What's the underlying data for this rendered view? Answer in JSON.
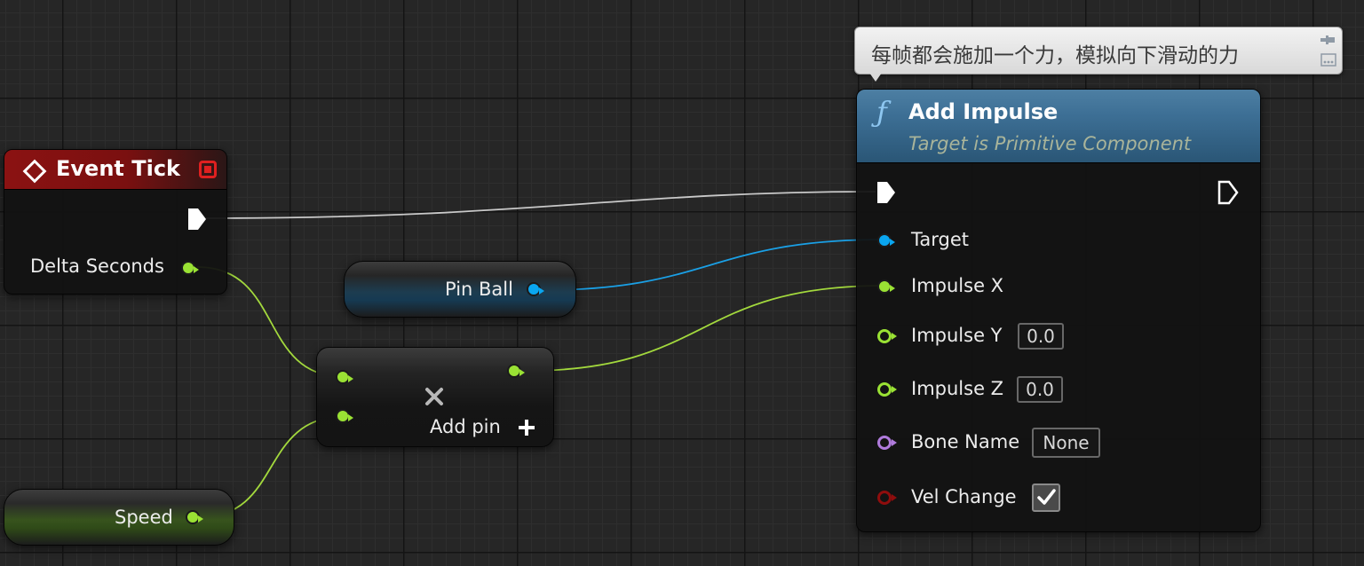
{
  "comment": {
    "text": "每帧都会施加一个力，模拟向下滑动的力"
  },
  "event_tick": {
    "title": "Event Tick",
    "delta_seconds_label": "Delta Seconds"
  },
  "pin_ball": {
    "label": "Pin Ball"
  },
  "multiply_node": {
    "add_pin_label": "Add pin"
  },
  "speed": {
    "label": "Speed"
  },
  "add_impulse": {
    "title": "Add Impulse",
    "subtitle": "Target is Primitive Component",
    "target_label": "Target",
    "impulse_x_label": "Impulse X",
    "impulse_y_label": "Impulse Y",
    "impulse_y_value": "0.0",
    "impulse_z_label": "Impulse Z",
    "impulse_z_value": "0.0",
    "bone_name_label": "Bone Name",
    "bone_name_value": "None",
    "vel_change_label": "Vel Change",
    "vel_change_checked": true
  },
  "colors": {
    "exec_wire": "#cfcfcf",
    "float_pin": "#9ae234",
    "object_pin": "#0aa6f0",
    "name_pin": "#b07bdc",
    "bool_pin": "#8f0d0d",
    "event_header": "#8b1212",
    "function_header": "#3d6f95"
  }
}
